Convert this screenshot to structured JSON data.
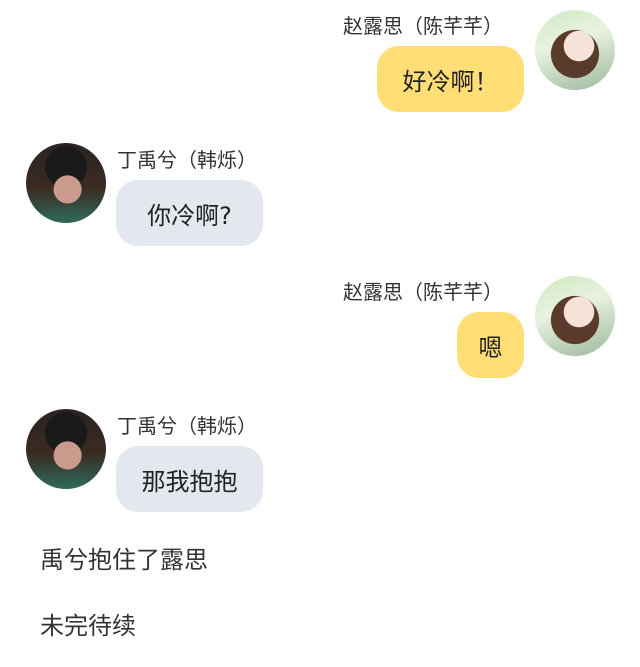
{
  "messages": [
    {
      "sender": "赵露思（陈芊芊）",
      "text": "好冷啊！",
      "side": "right"
    },
    {
      "sender": "丁禹兮（韩烁）",
      "text": "你冷啊?",
      "side": "left"
    },
    {
      "sender": "赵露思（陈芊芊）",
      "text": "嗯",
      "side": "right"
    },
    {
      "sender": "丁禹兮（韩烁）",
      "text": "那我抱抱",
      "side": "left"
    }
  ],
  "narration": [
    "禹兮抱住了露思",
    "未完待续"
  ],
  "colors": {
    "right_bubble": "#ffde75",
    "left_bubble": "#e3e8ef",
    "background": "#ffffff"
  }
}
